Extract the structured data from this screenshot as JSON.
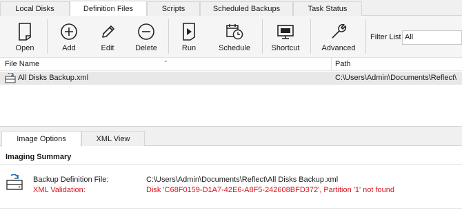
{
  "tabs": [
    {
      "label": "Local Disks"
    },
    {
      "label": "Definition Files"
    },
    {
      "label": "Scripts"
    },
    {
      "label": "Scheduled Backups"
    },
    {
      "label": "Task Status"
    }
  ],
  "toolbar": {
    "open": "Open",
    "add": "Add",
    "edit": "Edit",
    "delete": "Delete",
    "run": "Run",
    "schedule": "Schedule",
    "shortcut": "Shortcut",
    "advanced": "Advanced",
    "filter_label": "Filter List",
    "filter_value": "All"
  },
  "file_list": {
    "col_name": "File Name",
    "col_path": "Path",
    "rows": [
      {
        "name": "All Disks Backup.xml",
        "path": "C:\\Users\\Admin\\Documents\\Reflect\\"
      }
    ]
  },
  "bottom_tabs": [
    {
      "label": "Image Options"
    },
    {
      "label": "XML View"
    }
  ],
  "summary": {
    "title": "Imaging Summary",
    "def_file_label": "Backup Definition File:",
    "def_file_value": "C:\\Users\\Admin\\Documents\\Reflect\\All Disks Backup.xml",
    "xml_label": "XML Validation:",
    "xml_value": "Disk 'C68F0159-D1A7-42E6-A8F5-242608BFD372', Partition '1' not found"
  },
  "colors": {
    "error": "#d9141b",
    "selected_row": "#e8e8e8",
    "icon_blue": "#1f6fb2"
  }
}
